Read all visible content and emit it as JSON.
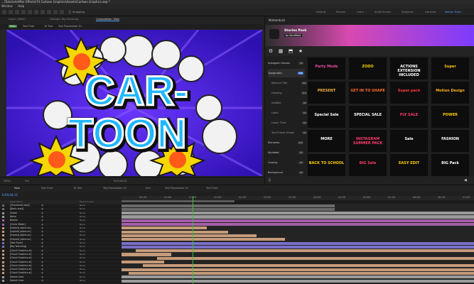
{
  "title": "...\\Tutorials\\After Effects\\74 Cartoon Graphics\\Assets\\Cartoon Graphics.aep *",
  "menu": [
    "Window",
    "Help"
  ],
  "workspaces": [
    "Default",
    "Review",
    "Learn",
    "Small Screen",
    "Standard",
    "Libraries",
    "Motion Track"
  ],
  "toolbar": {
    "snapping_label": "Snapping"
  },
  "panel_tabs": [
    "Layer: [Main]",
    "Footage: Big Texturing",
    "Composition: Main"
  ],
  "comp_tabs": [
    "Main",
    "Text Float",
    "1K Text",
    "Text Placeholder 01"
  ],
  "viewer": {
    "zoom": "(50%)",
    "quality": "Full",
    "timecode": "0;00;04;12"
  },
  "right_panel": {
    "title": "Motionduck",
    "banner_title": "Stories Pack",
    "banner_sub": "by Sendfeed",
    "categories": [
      {
        "label": "Instagram Stories",
        "badge": "56"
      },
      {
        "label": "Typography",
        "badge": "590"
      },
      {
        "label": "Minimal Title",
        "badge": "105"
      },
      {
        "label": "Heading",
        "badge": "110"
      },
      {
        "label": "Subtitle",
        "badge": "95"
      },
      {
        "label": "Label",
        "badge": "65"
      },
      {
        "label": "Lower Third",
        "badge": "80"
      },
      {
        "label": "Text Preset Simple",
        "badge": "35"
      },
      {
        "label": "Elements",
        "badge": "270"
      },
      {
        "label": "Alphabet",
        "badge": "54"
      },
      {
        "label": "Overlay",
        "badge": "20"
      },
      {
        "label": "Background",
        "badge": "42"
      }
    ],
    "tiles": [
      {
        "label": "Party Mode",
        "color": "#e84a9f"
      },
      {
        "label": "ZODO",
        "color": "#f5d000"
      },
      {
        "label": "ACTIONS EXTENSION INCLUDED",
        "color": "#ffffff"
      },
      {
        "label": "Super",
        "color": "#f7c31a"
      },
      {
        "label": "PRESENT",
        "color": "#f0b23a"
      },
      {
        "label": "GET IN TO SHAPE",
        "color": "#ff6a2a"
      },
      {
        "label": "Super pack",
        "color": "#ff3b3b"
      },
      {
        "label": "Motion Design",
        "color": "#ffb020"
      },
      {
        "label": "Special Sale",
        "color": "#ffffff"
      },
      {
        "label": "SPECIAL SALE",
        "color": "#ffffff"
      },
      {
        "label": "FLY SALE",
        "color": "#ff3b6b"
      },
      {
        "label": "POWER",
        "color": "#ffcc00"
      },
      {
        "label": "MORE",
        "color": "#ffffff"
      },
      {
        "label": "INSTAGRAM SUMMER PACK",
        "color": "#ff3b6b"
      },
      {
        "label": "Sale",
        "color": "#ffffff"
      },
      {
        "label": "FASHION",
        "color": "#ffffff"
      },
      {
        "label": "BACK TO SCHOOL",
        "color": "#ffcc00"
      },
      {
        "label": "BIG Sale",
        "color": "#ff3b6b"
      },
      {
        "label": "EASY EDIT",
        "color": "#ffcc00"
      },
      {
        "label": "BIG Pack",
        "color": "#ffffff"
      }
    ]
  },
  "timeline": {
    "tabs": [
      "Main",
      "Text Float",
      "1K Text",
      "Text Placeholder 01",
      "Null",
      "Text Placeholder 01",
      "Text Float"
    ],
    "time": "0;00;04;12",
    "ruler_ticks": [
      "00:15f",
      "01:00f",
      "01:15f",
      "02:00f",
      "02:15f",
      "03:00f",
      "03:15f",
      "04:00f",
      "04:15f",
      "05:00f",
      "05:15f",
      "06:00f",
      "06:15f",
      "07:00f"
    ],
    "columns": [
      "Layer Name",
      "Parent & Link"
    ],
    "layers": [
      {
        "name": "[Thumbnail.mp4]",
        "parent": "None",
        "color": "#6a6a6a"
      },
      {
        "name": "[Basic.mp4]",
        "parent": "None",
        "color": "#6a6a6a"
      },
      {
        "name": "Shake",
        "parent": "None",
        "color": "#9b9b9b"
      },
      {
        "name": "Noise",
        "parent": "None",
        "color": "#9b9b9b"
      },
      {
        "name": "Blanke",
        "parent": "None",
        "color": "#a65fa8"
      },
      {
        "name": "[Circle Matte]",
        "parent": "None",
        "color": "#a65fa8"
      },
      {
        "name": "[Exploid_alpha.av]",
        "parent": "None",
        "color": "#c59a7a"
      },
      {
        "name": "[Exploid_alpha.av]",
        "parent": "None",
        "color": "#c59a7a"
      },
      {
        "name": "[Exploid_alpha.av]",
        "parent": "None",
        "color": "#c59a7a"
      },
      {
        "name": "[Exploid_alpha.av]",
        "parent": "None",
        "color": "#c59a7a"
      },
      {
        "name": "[Text Float]",
        "parent": "None",
        "color": "#7a6fc9"
      },
      {
        "name": "[Big Texturing]",
        "parent": "None",
        "color": "#7a6fc9"
      },
      {
        "name": "[Cloud Graphics.ai]",
        "parent": "None",
        "color": "#c59a7a"
      },
      {
        "name": "[Cloud Graphics.ai]",
        "parent": "None",
        "color": "#c59a7a"
      },
      {
        "name": "[Cloud Graphics.ai]",
        "parent": "None",
        "color": "#c59a7a"
      },
      {
        "name": "[Cloud Graphics.ai]",
        "parent": "None",
        "color": "#c59a7a"
      },
      {
        "name": "[Cloud Graphics.ai]",
        "parent": "None",
        "color": "#c59a7a"
      },
      {
        "name": "[Cloud Graphics.ai]",
        "parent": "None",
        "color": "#c59a7a"
      },
      {
        "name": "[Cloud Graphics.ai]",
        "parent": "None",
        "color": "#c59a7a"
      },
      {
        "name": "Speed Lines",
        "parent": "None",
        "color": "#9b9b9b"
      },
      {
        "name": "Speed Lines",
        "parent": "None",
        "color": "#9b9b9b"
      }
    ]
  },
  "artwork": {
    "line1": "CAR-",
    "line2": "TOON"
  }
}
